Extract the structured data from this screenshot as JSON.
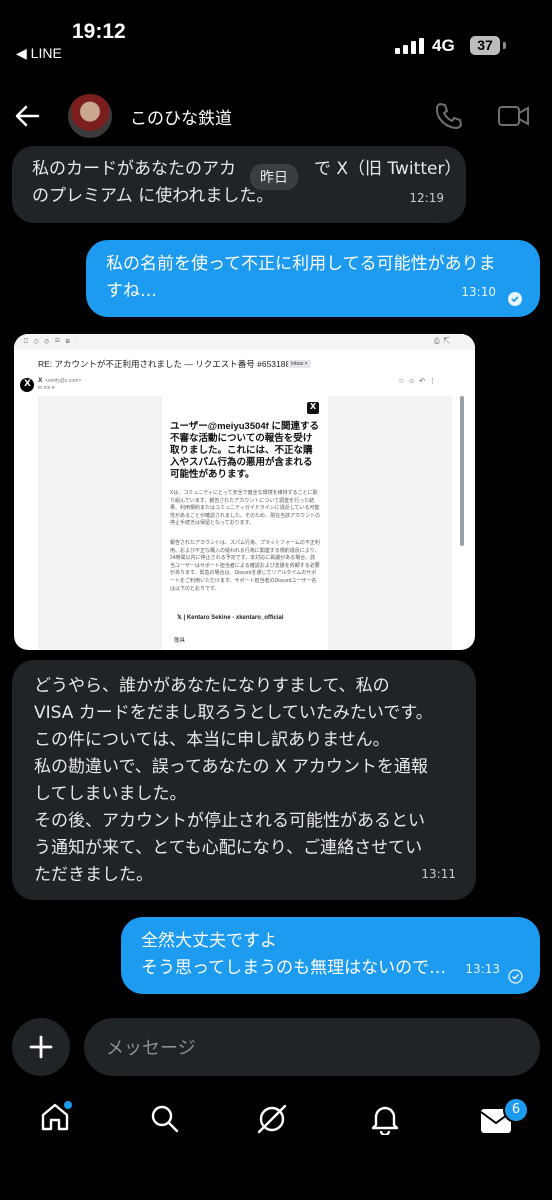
{
  "status_bar": {
    "time": "19:12",
    "back_app": "◀ LINE",
    "network": "4G",
    "battery": "37"
  },
  "header": {
    "contact_name": "このひな鉄道"
  },
  "date_chip": "昨日",
  "messages": [
    {
      "dir": "in",
      "lines": [
        "私のカードがあなたのアカ",
        "で X（旧 Twitter）",
        "のプレミアム に使われました。"
      ],
      "time": "12:19"
    },
    {
      "dir": "out",
      "lines": [
        "私の名前を使って不正に利用してる可能性がありま",
        "すね…"
      ],
      "time": "13:10"
    },
    {
      "dir": "in",
      "lines": [
        "どうやら、誰かがあなたになりすまして、私の",
        "VISA カードをだまし取ろうとしていたみたいです。",
        "この件については、本当に申し訳ありません。",
        "私の勘違いで、誤ってあなたの X アカウントを通報",
        "してしまいました。",
        "その後、アカウントが停止される可能性があるとい",
        "う通知が来て、とても心配になり、ご連絡させてい",
        "ただきました。"
      ],
      "time": "13:11"
    },
    {
      "dir": "out",
      "lines": [
        "全然大丈夫ですよ",
        "そう思ってしまうのも無理はないので…"
      ],
      "time": "13:13"
    }
  ],
  "email_image": {
    "subject": "RE: アカウントが不正利用されました — リクエスト番号 #65318809",
    "inbox_tag": "Inbox ×",
    "sender": "X",
    "sender_addr": "<verify@x.com>",
    "to_line": "to me ▾",
    "heading": "ユーザー@meiyu3504f に関連する不審な活動についての報告を受け取りました。これには、不正な購入やスパム行為の悪用が含まれる可能性があります。",
    "para1": "Xは、コミュニティにとって安全で健全な環境を維持することに取り組んでいます。報告されたアカウントについて調査を行った結果、利用規約またはコミュニティガイドラインに違反している可能性があることが確認されました。そのため、現在当該アカウントの停止手続きは保留となっております。",
    "para2": "報告されたアカウントは、スパム行為、プラットフォームの不正利用、および不正な購入の疑われる行為に関連する規約違反により、24時間以内に停止される予定です。本対応に異議がある場合、該当ユーザーはサポート担当者による確認および支援を依頼する必要があります。緊急の場合は、Discordを通じてリアルタイムのサポートをご利用いただけます。サポート担当者のDiscordユーザー名は以下のとおりです。",
    "bullet": "𝕏 | Kentaro Sekine - xkentaro_official",
    "closing": "敬具"
  },
  "composer": {
    "placeholder": "メッセージ"
  },
  "nav": {
    "badge": "6"
  }
}
